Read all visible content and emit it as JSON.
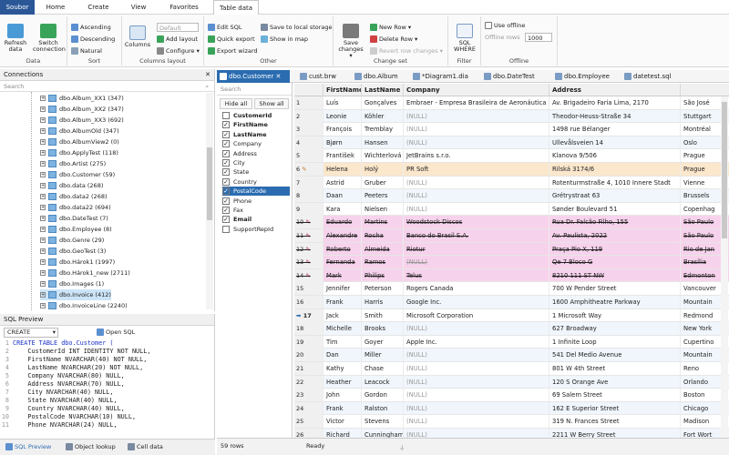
{
  "menu_tabs": [
    "Soubor",
    "Home",
    "Create",
    "View",
    "Favorites",
    "Table data"
  ],
  "ribbon": {
    "data": {
      "label": "Data",
      "refresh": "Refresh data",
      "switch": "Switch connection"
    },
    "sort": {
      "label": "Sort",
      "asc": "Ascending",
      "desc": "Descending",
      "natural": "Natural"
    },
    "layout": {
      "label": "Columns layout",
      "default_value": "Default",
      "columns": "Columns",
      "add": "Add layout",
      "configure": "Configure"
    },
    "other": {
      "label": "Other",
      "edit_sql": "Edit SQL",
      "quick_export": "Quick export",
      "export_wizard": "Export wizard",
      "save_local": "Save to local storage",
      "show_map": "Show in map"
    },
    "changeset": {
      "label": "Change set",
      "save": "Save changes",
      "new_row": "New Row",
      "delete_row": "Delete Row",
      "revert": "Revert row changes"
    },
    "filter": {
      "label": "Filter",
      "sql_where": "SQL WHERE"
    },
    "offline": {
      "label": "Offline",
      "use_offline": "Use offline",
      "offline_rows": "Offline rows",
      "rows_value": "1000"
    }
  },
  "connections": {
    "title": "Connections",
    "search": "Search",
    "items": [
      "dbo.Album_XX1 (347)",
      "dbo.Album_XX2 (347)",
      "dbo.Album_XX3 (692)",
      "dbo.AlbumOld (347)",
      "dbo.AlbumView2 (0)",
      "dbo.ApplyTest (118)",
      "dbo.Artist (275)",
      "dbo.Customer (59)",
      "dbo.data (268)",
      "dbo.data2 (268)",
      "dbo.data22 (694)",
      "dbo.DateTest (7)",
      "dbo.Employee (8)",
      "dbo.Genre (29)",
      "dbo.GeoTest (3)",
      "dbo.Hárok1 (1997)",
      "dbo.Hárok1_new (2711)",
      "dbo.Images (1)",
      "dbo.Invoice (412)",
      "dbo.InvoiceLine (2240)"
    ],
    "selected_index": 18
  },
  "sql_preview": {
    "title": "SQL Preview",
    "mode": "CREATE",
    "open": "Open SQL",
    "lines": [
      "CREATE TABLE dbo.Customer (",
      "    CustomerId INT IDENTITY NOT NULL,",
      "    FirstName NVARCHAR(40) NOT NULL,",
      "    LastName NVARCHAR(20) NOT NULL,",
      "    Company NVARCHAR(80) NULL,",
      "    Address NVARCHAR(70) NULL,",
      "    City NVARCHAR(40) NULL,",
      "    State NVARCHAR(40) NULL,",
      "    Country NVARCHAR(40) NULL,",
      "    PostalCode NVARCHAR(10) NULL,",
      "    Phone NVARCHAR(24) NULL,"
    ]
  },
  "bottom_tabs": [
    "SQL Preview",
    "Object lookup",
    "Cell data"
  ],
  "doc_tabs": [
    "dbo.Customer",
    "cust.brw",
    "dbo.Album",
    "*Diagram1.dia",
    "dbo.DateTest",
    "dbo.Employee",
    "datetest.sql"
  ],
  "columns_panel": {
    "search": "Search",
    "hide_all": "Hide all",
    "show_all": "Show all",
    "items": [
      {
        "name": "CustomerId",
        "checked": false,
        "bold": true
      },
      {
        "name": "FirstName",
        "checked": true,
        "bold": true
      },
      {
        "name": "LastName",
        "checked": true,
        "bold": true
      },
      {
        "name": "Company",
        "checked": true,
        "bold": false
      },
      {
        "name": "Address",
        "checked": true,
        "bold": false
      },
      {
        "name": "City",
        "checked": true,
        "bold": false
      },
      {
        "name": "State",
        "checked": true,
        "bold": false
      },
      {
        "name": "Country",
        "checked": true,
        "bold": false
      },
      {
        "name": "PostalCode",
        "checked": true,
        "bold": false,
        "selected": true
      },
      {
        "name": "Phone",
        "checked": true,
        "bold": false
      },
      {
        "name": "Fax",
        "checked": true,
        "bold": false
      },
      {
        "name": "Email",
        "checked": true,
        "bold": true
      },
      {
        "name": "SupportRepId",
        "checked": false,
        "bold": false
      }
    ]
  },
  "grid": {
    "headers": [
      "",
      "FirstName",
      "LastName",
      "Company",
      "Address",
      ""
    ],
    "rows": [
      {
        "n": "1",
        "s": "",
        "c": [
          "Luís",
          "Gonçalves",
          "Embraer - Empresa Brasileira de Aeronáutica S.A.",
          "Av. Brigadeiro Faria Lima, 2170",
          "São José"
        ]
      },
      {
        "n": "2",
        "s": "",
        "c": [
          "Leonie",
          "Köhler",
          "(NULL)",
          "Theodor-Heuss-Straße 34",
          "Stuttgart"
        ]
      },
      {
        "n": "3",
        "s": "",
        "c": [
          "François",
          "Tremblay",
          "(NULL)",
          "1498 rue Bélanger",
          "Montréal"
        ]
      },
      {
        "n": "4",
        "s": "",
        "c": [
          "Bjørn",
          "Hansen",
          "(NULL)",
          "Ullevålsveien 14",
          "Oslo"
        ]
      },
      {
        "n": "5",
        "s": "",
        "c": [
          "František",
          "Wichterlová",
          "JetBrains s.r.o.",
          "Klanova 9/506",
          "Prague"
        ]
      },
      {
        "n": "6",
        "s": "edit",
        "c": [
          "Helena",
          "Holý",
          "PR Soft",
          "Rilská 3174/6",
          "Prague"
        ]
      },
      {
        "n": "7",
        "s": "",
        "c": [
          "Astrid",
          "Gruber",
          "(NULL)",
          "Rotenturmstraße 4, 1010 Innere Stadt",
          "Vienne"
        ]
      },
      {
        "n": "8",
        "s": "",
        "c": [
          "Daan",
          "Peeters",
          "(NULL)",
          "Grétrystraat 63",
          "Brussels"
        ]
      },
      {
        "n": "9",
        "s": "",
        "c": [
          "Kara",
          "Nielsen",
          "(NULL)",
          "Sønder Boulevard 51",
          "Copenhag"
        ]
      },
      {
        "n": "10",
        "s": "del",
        "c": [
          "Eduardo",
          "Martins",
          "Woodstock Discos",
          "Rua Dr. Falcão Filho, 155",
          "São Paulo"
        ]
      },
      {
        "n": "11",
        "s": "del",
        "c": [
          "Alexandre",
          "Rocha",
          "Banco do Brasil S.A.",
          "Av. Paulista, 2022",
          "São Paulo"
        ]
      },
      {
        "n": "12",
        "s": "del",
        "c": [
          "Roberto",
          "Almeida",
          "Riotur",
          "Praça Pio X, 119",
          "Rio de Jan"
        ]
      },
      {
        "n": "13",
        "s": "del",
        "c": [
          "Fernanda",
          "Ramos",
          "(NULL)",
          "Qe 7 Bloco G",
          "Brasília"
        ]
      },
      {
        "n": "14",
        "s": "del",
        "c": [
          "Mark",
          "Philips",
          "Telus",
          "8210 111 ST NW",
          "Edmonton"
        ]
      },
      {
        "n": "15",
        "s": "",
        "c": [
          "Jennifer",
          "Peterson",
          "Rogers Canada",
          "700 W Pender Street",
          "Vancouver"
        ]
      },
      {
        "n": "16",
        "s": "",
        "c": [
          "Frank",
          "Harris",
          "Google Inc.",
          "1600 Amphitheatre Parkway",
          "Mountain"
        ]
      },
      {
        "n": "17",
        "s": "cur",
        "c": [
          "Jack",
          "Smith",
          "Microsoft Corporation",
          "1 Microsoft Way",
          "Redmond"
        ]
      },
      {
        "n": "18",
        "s": "",
        "c": [
          "Michelle",
          "Brooks",
          "(NULL)",
          "627 Broadway",
          "New York"
        ]
      },
      {
        "n": "19",
        "s": "",
        "c": [
          "Tim",
          "Goyer",
          "Apple Inc.",
          "1 Infinite Loop",
          "Cupertino"
        ]
      },
      {
        "n": "20",
        "s": "",
        "c": [
          "Dan",
          "Miller",
          "(NULL)",
          "541 Del Medio Avenue",
          "Mountain"
        ]
      },
      {
        "n": "21",
        "s": "",
        "c": [
          "Kathy",
          "Chase",
          "(NULL)",
          "801 W 4th Street",
          "Reno"
        ]
      },
      {
        "n": "22",
        "s": "",
        "c": [
          "Heather",
          "Leacock",
          "(NULL)",
          "120 S Orange Ave",
          "Orlando"
        ]
      },
      {
        "n": "23",
        "s": "",
        "c": [
          "John",
          "Gordon",
          "(NULL)",
          "69 Salem Street",
          "Boston"
        ]
      },
      {
        "n": "24",
        "s": "",
        "c": [
          "Frank",
          "Ralston",
          "(NULL)",
          "162 E Superior Street",
          "Chicago"
        ]
      },
      {
        "n": "25",
        "s": "",
        "c": [
          "Victor",
          "Stevens",
          "(NULL)",
          "319 N. Frances Street",
          "Madison"
        ]
      },
      {
        "n": "26",
        "s": "",
        "c": [
          "Richard",
          "Cunningham",
          "(NULL)",
          "2211 W Berry Street",
          "Fort Wort"
        ]
      },
      {
        "n": "27",
        "s": "",
        "c": [
          "Patrick",
          "Gray",
          "(NULL)",
          "1033 N Park Ave",
          "Tucson"
        ]
      }
    ]
  },
  "status": {
    "rows": "59 rows",
    "state": "Ready"
  },
  "colors": {
    "accent": "#2b6cb0",
    "deleted": "#f7d2ec",
    "edited": "#fbe7cc"
  }
}
